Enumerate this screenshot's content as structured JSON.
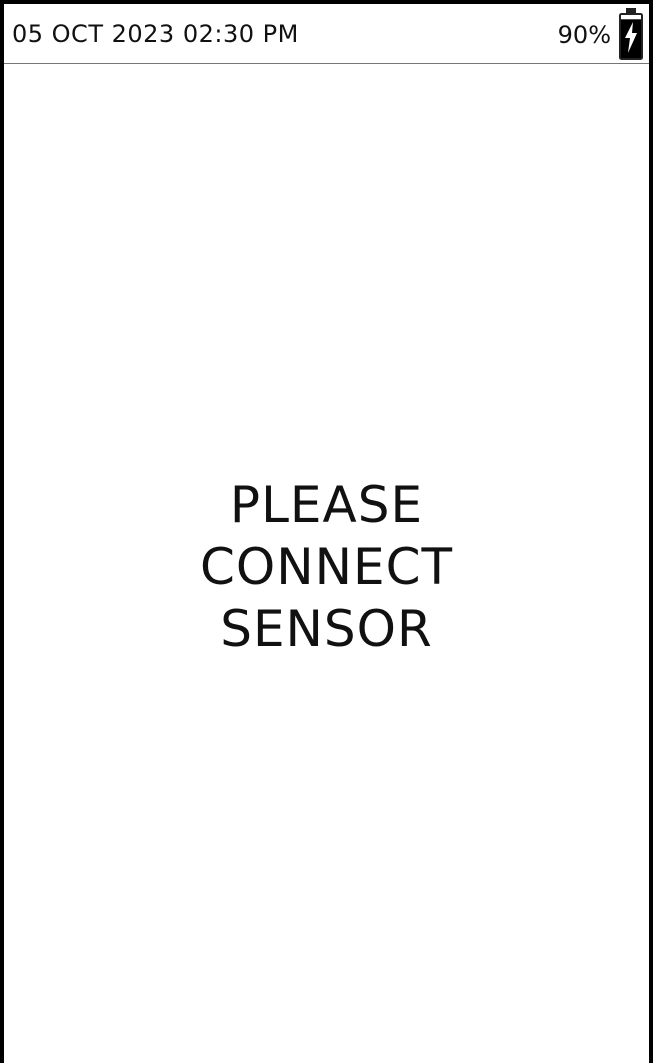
{
  "status_bar": {
    "datetime": "05 OCT 2023 02:30 PM",
    "battery_percent": "90%",
    "battery_level": 0.9,
    "charging": true,
    "icon": "battery-charging-icon"
  },
  "message": {
    "lines": [
      "PLEASE",
      "CONNECT",
      "SENSOR"
    ]
  },
  "colors": {
    "text": "#111111",
    "border": "#000000",
    "background": "#ffffff",
    "divider": "#777777"
  }
}
